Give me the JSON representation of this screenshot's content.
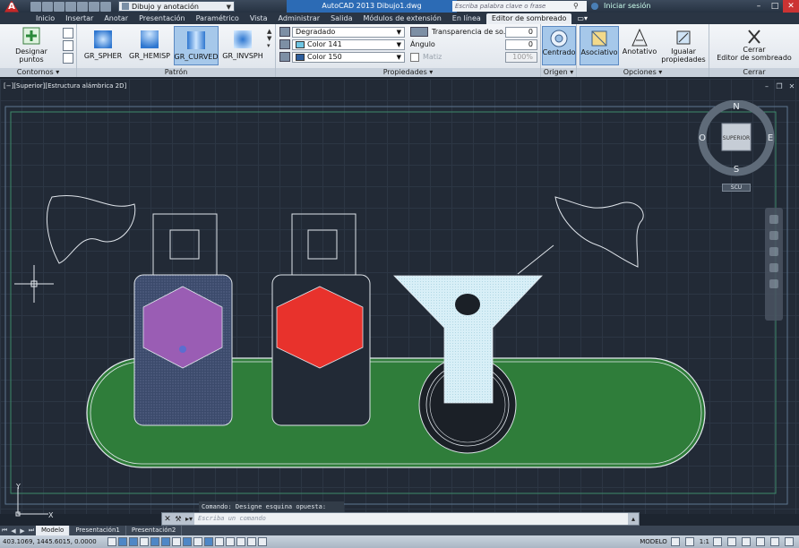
{
  "titlebar": {
    "workspace": "Dibujo y anotación",
    "title": "AutoCAD 2013    Dibujo1.dwg",
    "search_placeholder": "Escriba palabra clave o frase",
    "signin": "Iniciar sesión"
  },
  "tabs": [
    "Inicio",
    "Insertar",
    "Anotar",
    "Presentación",
    "Paramétrico",
    "Vista",
    "Administrar",
    "Salida",
    "Módulos de extensión",
    "En línea",
    "Editor de sombreado"
  ],
  "active_tab_index": 10,
  "ribbon": {
    "contornos": {
      "label": "Contornos",
      "pick_points": "Designar puntos"
    },
    "patron": {
      "label": "Patrón",
      "patterns": [
        "GR_SPHER",
        "GR_HEMISP",
        "GR_CURVED",
        "GR_INVSPH"
      ],
      "active_index": 2
    },
    "propiedades": {
      "label": "Propiedades",
      "type": "Degradado",
      "color1": "Color 141",
      "color2": "Color 150",
      "transparency_label": "Transparencia de so...",
      "transparency_value": "0",
      "angle_label": "Ángulo",
      "angle_value": "0",
      "tint_label": "Matiz",
      "tint_value": "100%"
    },
    "origen": {
      "label": "Origen",
      "centered": "Centrado"
    },
    "opciones": {
      "label": "Opciones",
      "associative": "Asociativo",
      "annotative": "Anotativo",
      "match1": "Igualar",
      "match2": "propiedades"
    },
    "cerrar": {
      "label": "Cerrar",
      "close1": "Cerrar",
      "close2": "Editor de sombreado"
    }
  },
  "viewport": {
    "label": "[−][Superior][Estructura alámbrica 2D]",
    "navcube_face": "SUPERIOR",
    "compass": {
      "n": "N",
      "s": "S",
      "e": "E",
      "w": "O"
    },
    "wcs": "SCU",
    "ucs_x": "X",
    "ucs_y": "Y"
  },
  "command": {
    "history": "Comando: Designe esquina opuesta:",
    "placeholder": "Escriba un comando"
  },
  "layout_tabs": [
    "Modelo",
    "Presentación1",
    "Presentación2"
  ],
  "active_layout_index": 0,
  "status": {
    "coords": "403.1069, 1445.6015, 0.0000",
    "model": "MODELO",
    "scale": "1:1"
  },
  "colors": {
    "green_track": "#2f7d3a",
    "purple_hex": "#9a5db4",
    "red_hex": "#e8322c",
    "navy_panel": "#3b4a6b",
    "cyan_hatch": "#d8eff7"
  }
}
